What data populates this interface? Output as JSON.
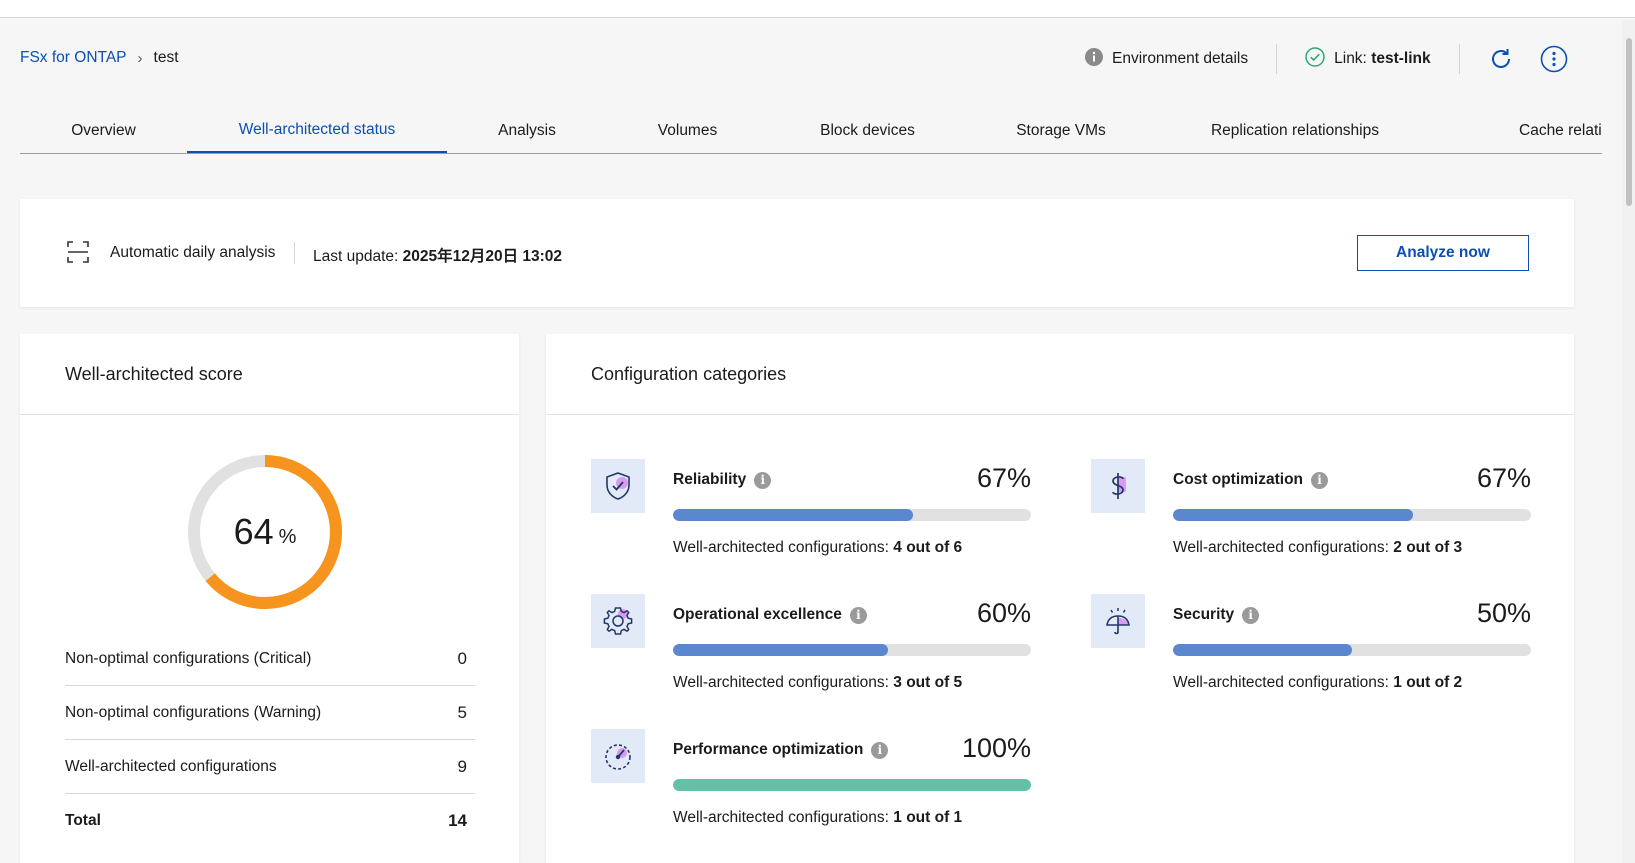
{
  "breadcrumb": {
    "root": "FSx for ONTAP",
    "current": "test"
  },
  "header": {
    "environment_details": "Environment details",
    "link_prefix": "Link:",
    "link_name": "test-link"
  },
  "tabs": [
    {
      "label": "Overview"
    },
    {
      "label": "Well-architected status",
      "active": true
    },
    {
      "label": "Analysis"
    },
    {
      "label": "Volumes"
    },
    {
      "label": "Block devices"
    },
    {
      "label": "Storage VMs"
    },
    {
      "label": "Replication relationships"
    },
    {
      "label": "Cache relati"
    }
  ],
  "analysis": {
    "automatic": "Automatic daily analysis",
    "last_update_label": "Last update:",
    "last_update_value": "2025年12月20日 13:02",
    "analyze_button": "Analyze now"
  },
  "score": {
    "title": "Well-architected score",
    "value": "64",
    "unit": "%",
    "fraction": 0.64,
    "colors": {
      "fill": "#f7941d",
      "track": "#e1e1e1"
    },
    "rows": [
      {
        "label": "Non-optimal configurations (Critical)",
        "value": "0"
      },
      {
        "label": "Non-optimal configurations (Warning)",
        "value": "5"
      },
      {
        "label": "Well-architected configurations",
        "value": "9"
      },
      {
        "label": "Total",
        "value": "14"
      }
    ]
  },
  "categories": {
    "title": "Configuration categories",
    "desc_label": "Well-architected configurations:",
    "items": [
      {
        "name": "Reliability",
        "percent": "67%",
        "fraction": 0.67,
        "count": "4 out of 6",
        "icon": "shield-check-icon"
      },
      {
        "name": "Cost optimization",
        "percent": "67%",
        "fraction": 0.67,
        "count": "2 out of 3",
        "icon": "dollar-icon"
      },
      {
        "name": "Operational excellence",
        "percent": "60%",
        "fraction": 0.6,
        "count": "3 out of 5",
        "icon": "gear-icon"
      },
      {
        "name": "Security",
        "percent": "50%",
        "fraction": 0.5,
        "count": "1 out of 2",
        "icon": "umbrella-icon"
      },
      {
        "name": "Performance optimization",
        "percent": "100%",
        "fraction": 1.0,
        "count": "1 out of 1",
        "icon": "gauge-icon"
      }
    ]
  },
  "colors": {
    "accent": "#0a4fb3",
    "bar": "#5b87cf",
    "bar_full": "#62c1a7",
    "success": "#2aa876"
  }
}
